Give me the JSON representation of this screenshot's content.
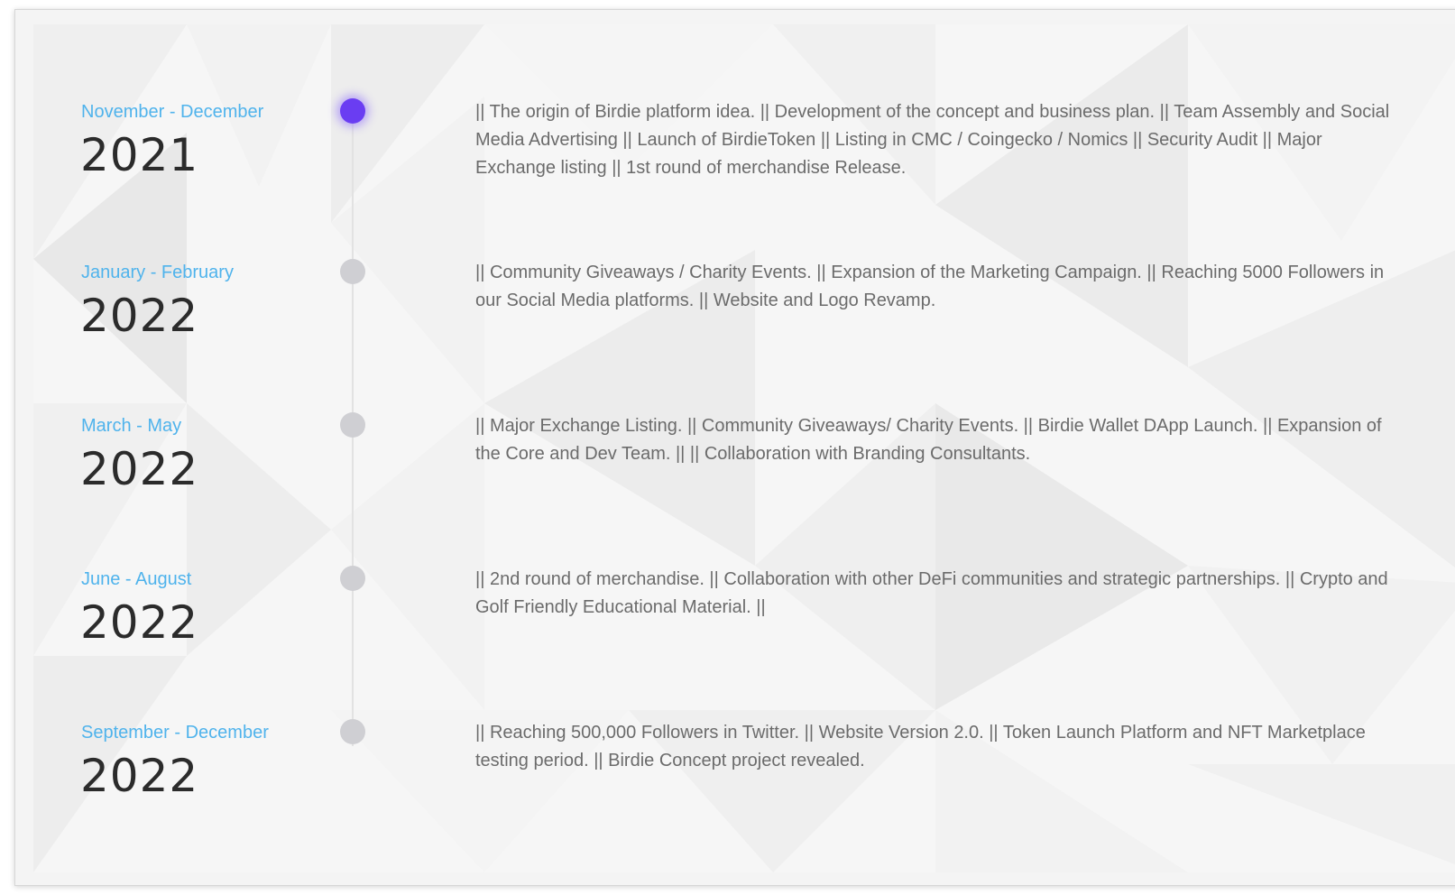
{
  "timeline": {
    "items": [
      {
        "period": "November - December",
        "year": "2021",
        "active": true,
        "description": "|| The origin of Birdie platform idea. || Development of the concept and business plan. || Team Assembly and Social Media Advertising || Launch of BirdieToken || Listing in CMC / Coingecko / Nomics || Security Audit || Major Exchange listing || 1st round of merchandise Release."
      },
      {
        "period": "January - February",
        "year": "2022",
        "active": false,
        "description": "|| Community Giveaways / Charity Events. || Expansion of the Marketing Campaign. || Reaching 5000 Followers in our Social Media platforms. || Website and Logo Revamp."
      },
      {
        "period": "March - May",
        "year": "2022",
        "active": false,
        "description": "|| Major Exchange Listing. || Community Giveaways/ Charity Events. || Birdie Wallet DApp Launch. || Expansion of the Core and Dev Team. || || Collaboration with Branding Consultants."
      },
      {
        "period": "June - August",
        "year": "2022",
        "active": false,
        "description": "|| 2nd round of merchandise. || Collaboration with other DeFi communities and strategic partnerships. || Crypto and Golf Friendly Educational Material. ||"
      },
      {
        "period": "September - December",
        "year": "2022",
        "active": false,
        "description": "|| Reaching 500,000 Followers in Twitter. || Website Version 2.0. || Token Launch Platform and NFT Marketplace testing period. || Birdie Concept project revealed."
      }
    ]
  },
  "colors": {
    "period": "#4fb3ec",
    "year": "#2b2b2b",
    "description": "#6b6b6b",
    "active_dot": "#6a3df2",
    "inactive_dot": "#cfcfd3"
  }
}
